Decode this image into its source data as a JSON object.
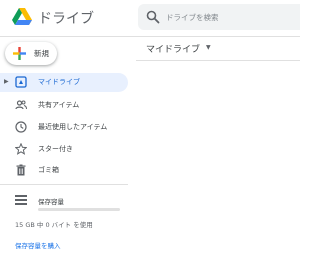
{
  "header": {
    "app_title": "ドライブ",
    "logo_icon": "google-drive-logo",
    "search": {
      "placeholder": "ドライブを検索",
      "icon": "search-icon"
    }
  },
  "new_button": {
    "label": "新規",
    "icon": "plus-icon"
  },
  "sidebar": {
    "items": [
      {
        "label": "マイドライブ",
        "icon": "my-drive-icon",
        "active": true
      },
      {
        "label": "共有アイテム",
        "icon": "shared-people-icon",
        "active": false
      },
      {
        "label": "最近使用したアイテム",
        "icon": "clock-icon",
        "active": false
      },
      {
        "label": "スター付き",
        "icon": "star-icon",
        "active": false
      },
      {
        "label": "ゴミ箱",
        "icon": "trash-icon",
        "active": false
      }
    ],
    "storage": {
      "title": "保存容量",
      "usage_text": "15 GB 中 0 バイト を使用",
      "used_fraction": 0,
      "buy_link": "保存容量を購入"
    }
  },
  "main": {
    "title": "マイドライブ"
  },
  "colors": {
    "accent": "#1a73e8",
    "active_bg": "#e8f0fe",
    "active_text": "#1967d2"
  }
}
